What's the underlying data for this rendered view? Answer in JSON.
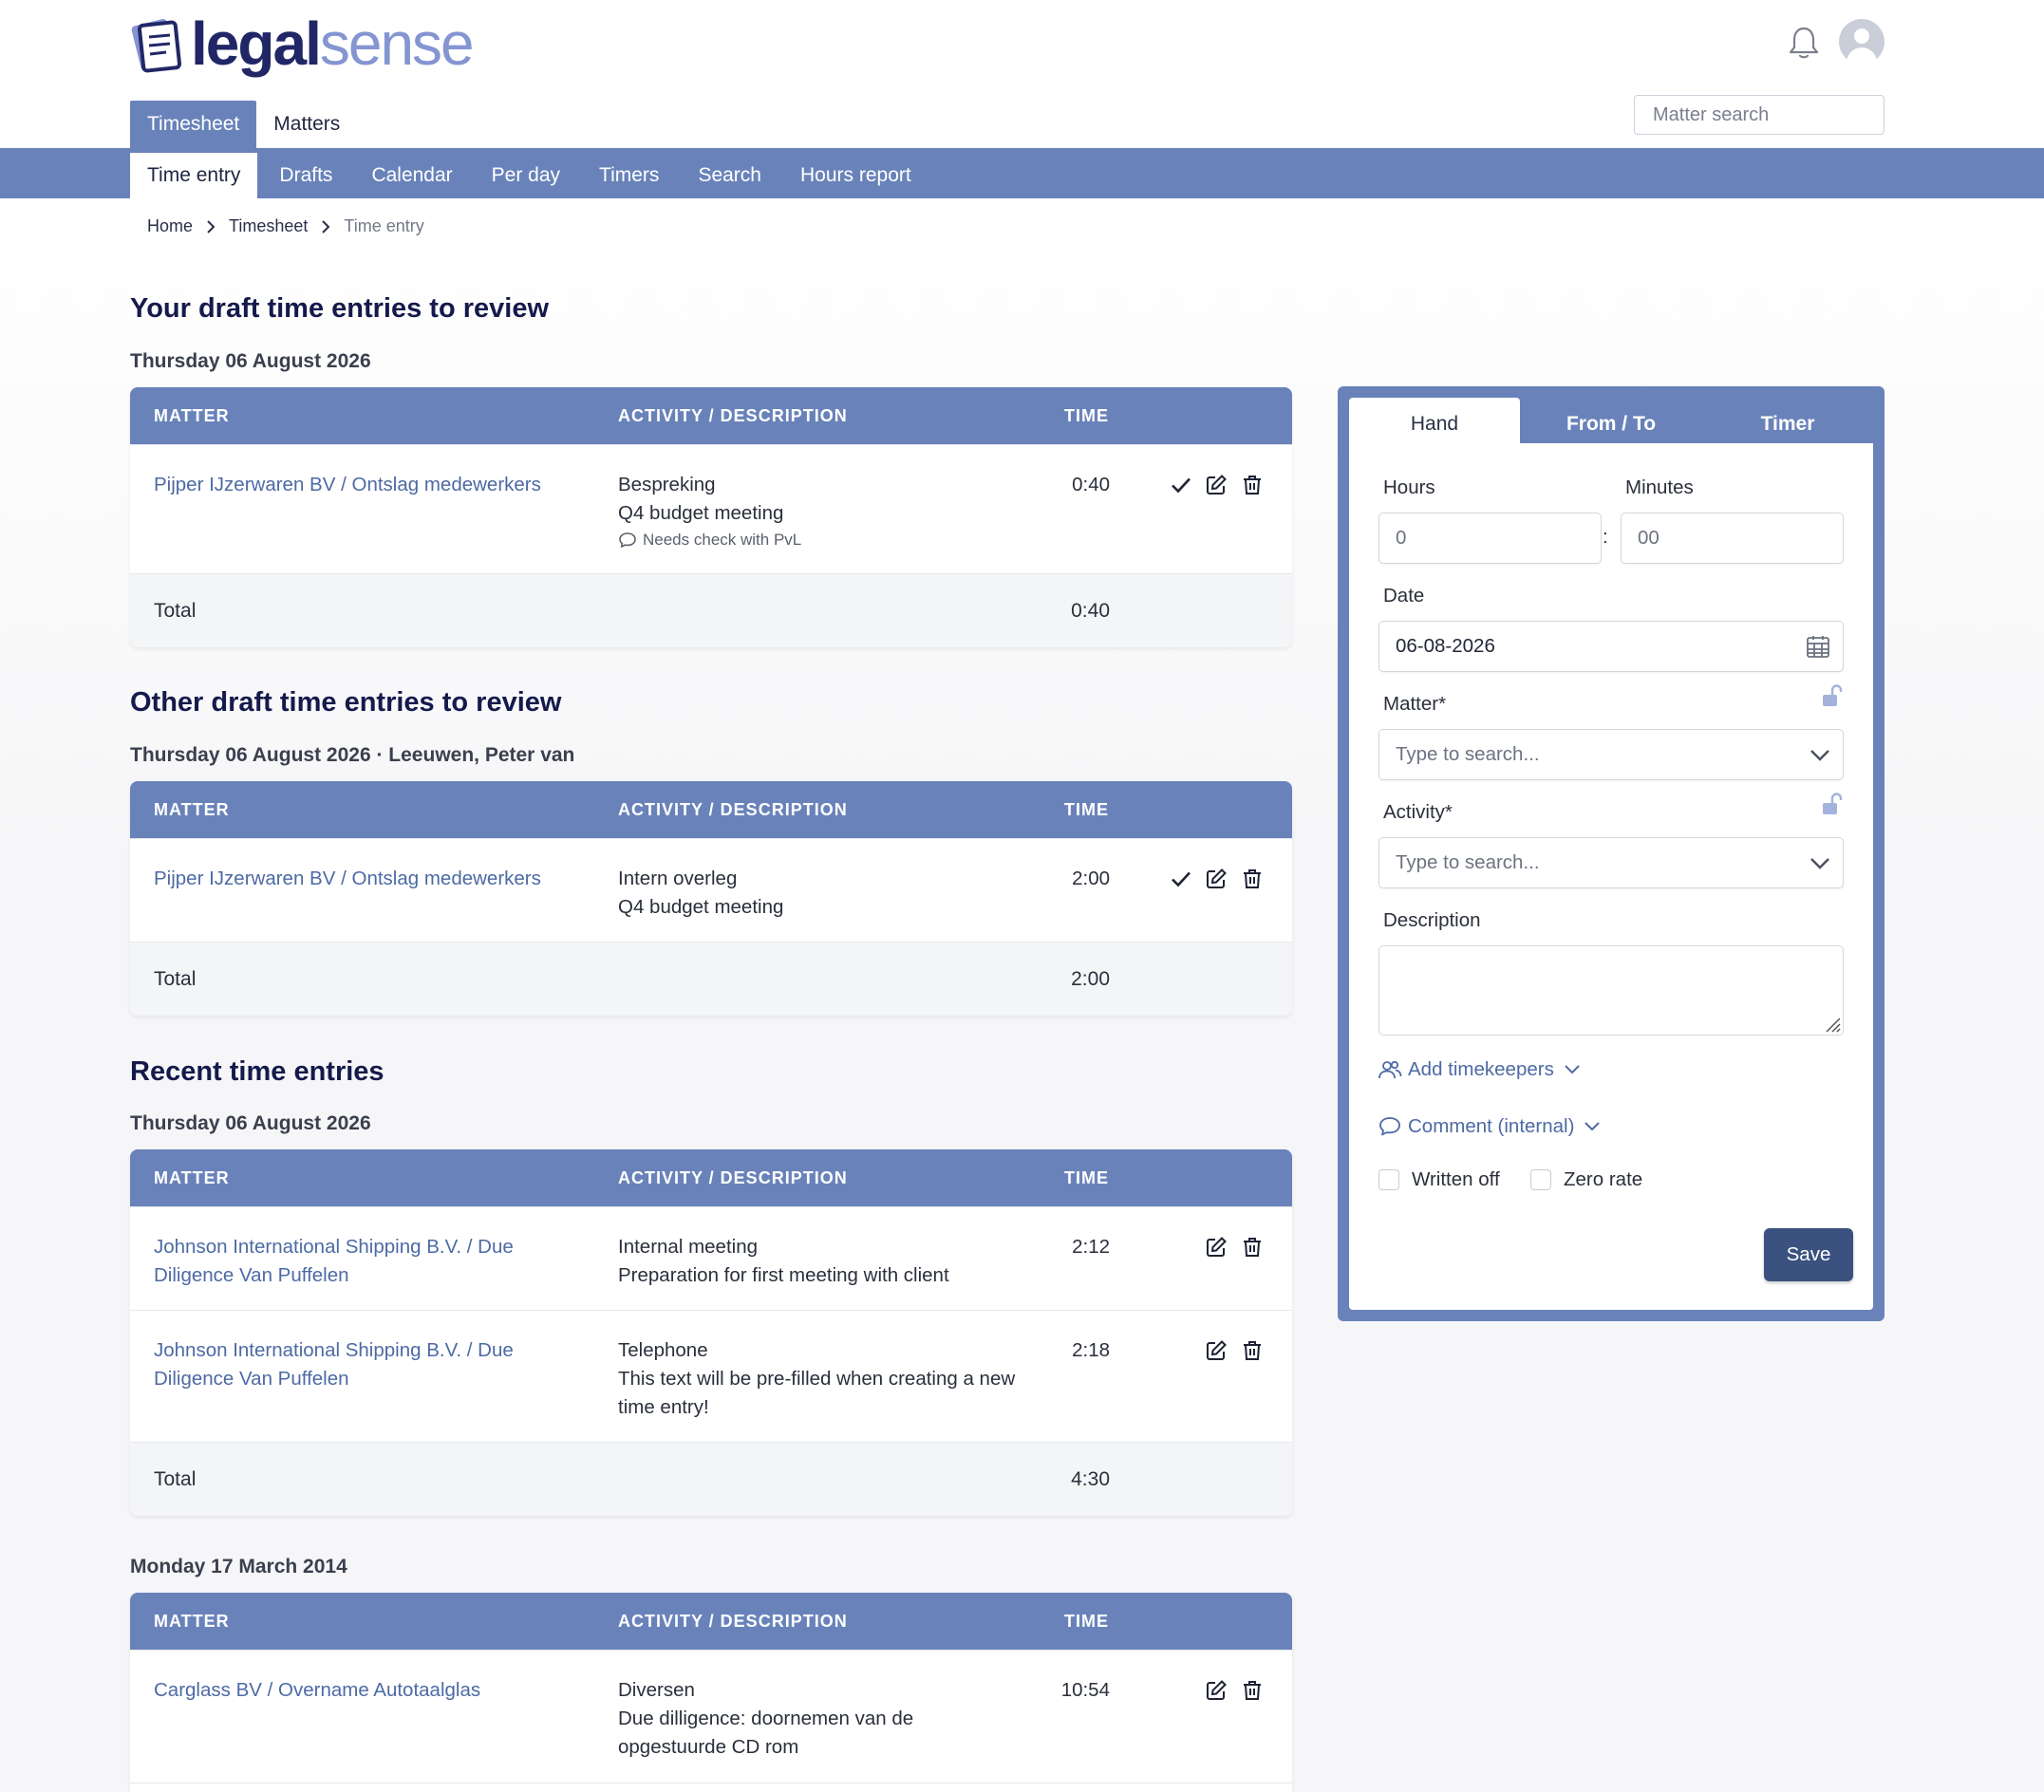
{
  "brand": {
    "part1": "legal",
    "part2": "sense"
  },
  "header": {
    "top_tabs": [
      {
        "label": "Timesheet"
      },
      {
        "label": "Matters"
      }
    ],
    "search_placeholder": "Matter search"
  },
  "subnav": [
    {
      "label": "Time entry"
    },
    {
      "label": "Drafts"
    },
    {
      "label": "Calendar"
    },
    {
      "label": "Per day"
    },
    {
      "label": "Timers"
    },
    {
      "label": "Search"
    },
    {
      "label": "Hours report"
    }
  ],
  "breadcrumb": {
    "home": "Home",
    "section": "Timesheet",
    "current": "Time entry"
  },
  "columns": {
    "matter": "MATTER",
    "activity": "ACTIVITY / DESCRIPTION",
    "time": "TIME"
  },
  "total_label": "Total",
  "your_drafts": {
    "title": "Your draft time entries to review",
    "date": "Thursday 06 August 2026",
    "rows": [
      {
        "matter": "Pijper IJzerwaren BV / Ontslag medewerkers",
        "activity": "Bespreking",
        "description": "Q4 budget meeting",
        "comment": "Needs check with PvL",
        "time": "0:40"
      }
    ],
    "total": "0:40"
  },
  "other_drafts": {
    "title": "Other draft time entries to review",
    "date": "Thursday 06 August 2026 · Leeuwen, Peter van",
    "rows": [
      {
        "matter": "Pijper IJzerwaren BV / Ontslag medewerkers",
        "activity": "Intern overleg",
        "description": "Q4 budget meeting",
        "time": "2:00"
      }
    ],
    "total": "2:00"
  },
  "recent": {
    "title": "Recent time entries",
    "groups": [
      {
        "date": "Thursday 06 August 2026",
        "rows": [
          {
            "matter": "Johnson International Shipping B.V. / Due Diligence Van Puffelen",
            "activity": "Internal meeting",
            "description": "Preparation for first meeting with client",
            "time": "2:12"
          },
          {
            "matter": "Johnson International Shipping B.V. / Due Diligence Van Puffelen",
            "activity": "Telephone",
            "description": "This text will be pre-filled when creating a new time entry!",
            "time": "2:18"
          }
        ],
        "total": "4:30"
      },
      {
        "date": "Monday 17 March 2014",
        "rows": [
          {
            "matter": "Carglass BV / Overname Autotaalglas",
            "activity": "Diversen",
            "description": "Due dilligence: doornemen van de opgestuurde CD rom",
            "time": "10:54"
          }
        ]
      }
    ]
  },
  "form": {
    "tabs": [
      {
        "label": "Hand"
      },
      {
        "label": "From / To"
      },
      {
        "label": "Timer"
      }
    ],
    "hours_label": "Hours",
    "hours_placeholder": "0",
    "minutes_label": "Minutes",
    "minutes_placeholder": "00",
    "colon": ":",
    "date_label": "Date",
    "date_value": "06-08-2026",
    "matter_label": "Matter*",
    "matter_placeholder": "Type to search...",
    "activity_label": "Activity*",
    "activity_placeholder": "Type to search...",
    "description_label": "Description",
    "add_timekeepers": "Add timekeepers",
    "comment_internal": "Comment (internal)",
    "written_off": "Written off",
    "zero_rate": "Zero rate",
    "save": "Save"
  },
  "colors": {
    "primary": "#6983ba",
    "link": "#4d6aa4",
    "heading": "#141a4b",
    "save": "#3b5280"
  }
}
